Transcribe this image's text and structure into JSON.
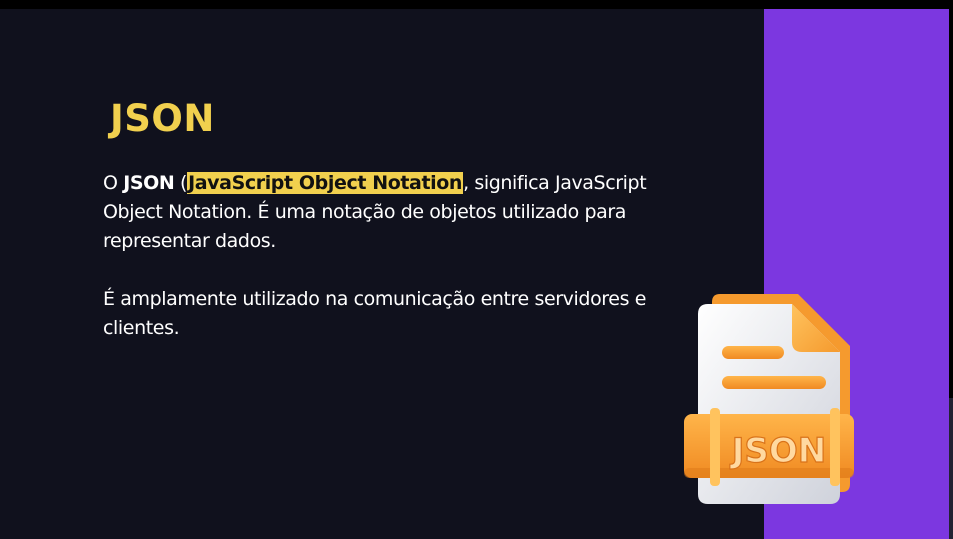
{
  "slide": {
    "title": "JSON",
    "paragraph1": {
      "prefix": "O ",
      "term": "JSON",
      "paren_open": " (",
      "expansion": "JavaScript Object Notation",
      "rest": ", significa JavaScript Object Notation. É uma notação de objetos utilizado para representar dados."
    },
    "paragraph2": "É amplamente utilizado na comunicação entre servidores e clientes.",
    "icon_label": "JSON",
    "icon": "json-file-icon"
  },
  "colors": {
    "background": "#10111d",
    "accent_panel": "#7c37e0",
    "title": "#f1d04e",
    "highlight": "#f1d04e",
    "body_text": "#ffffff",
    "icon_orange": "#f7a23b"
  }
}
